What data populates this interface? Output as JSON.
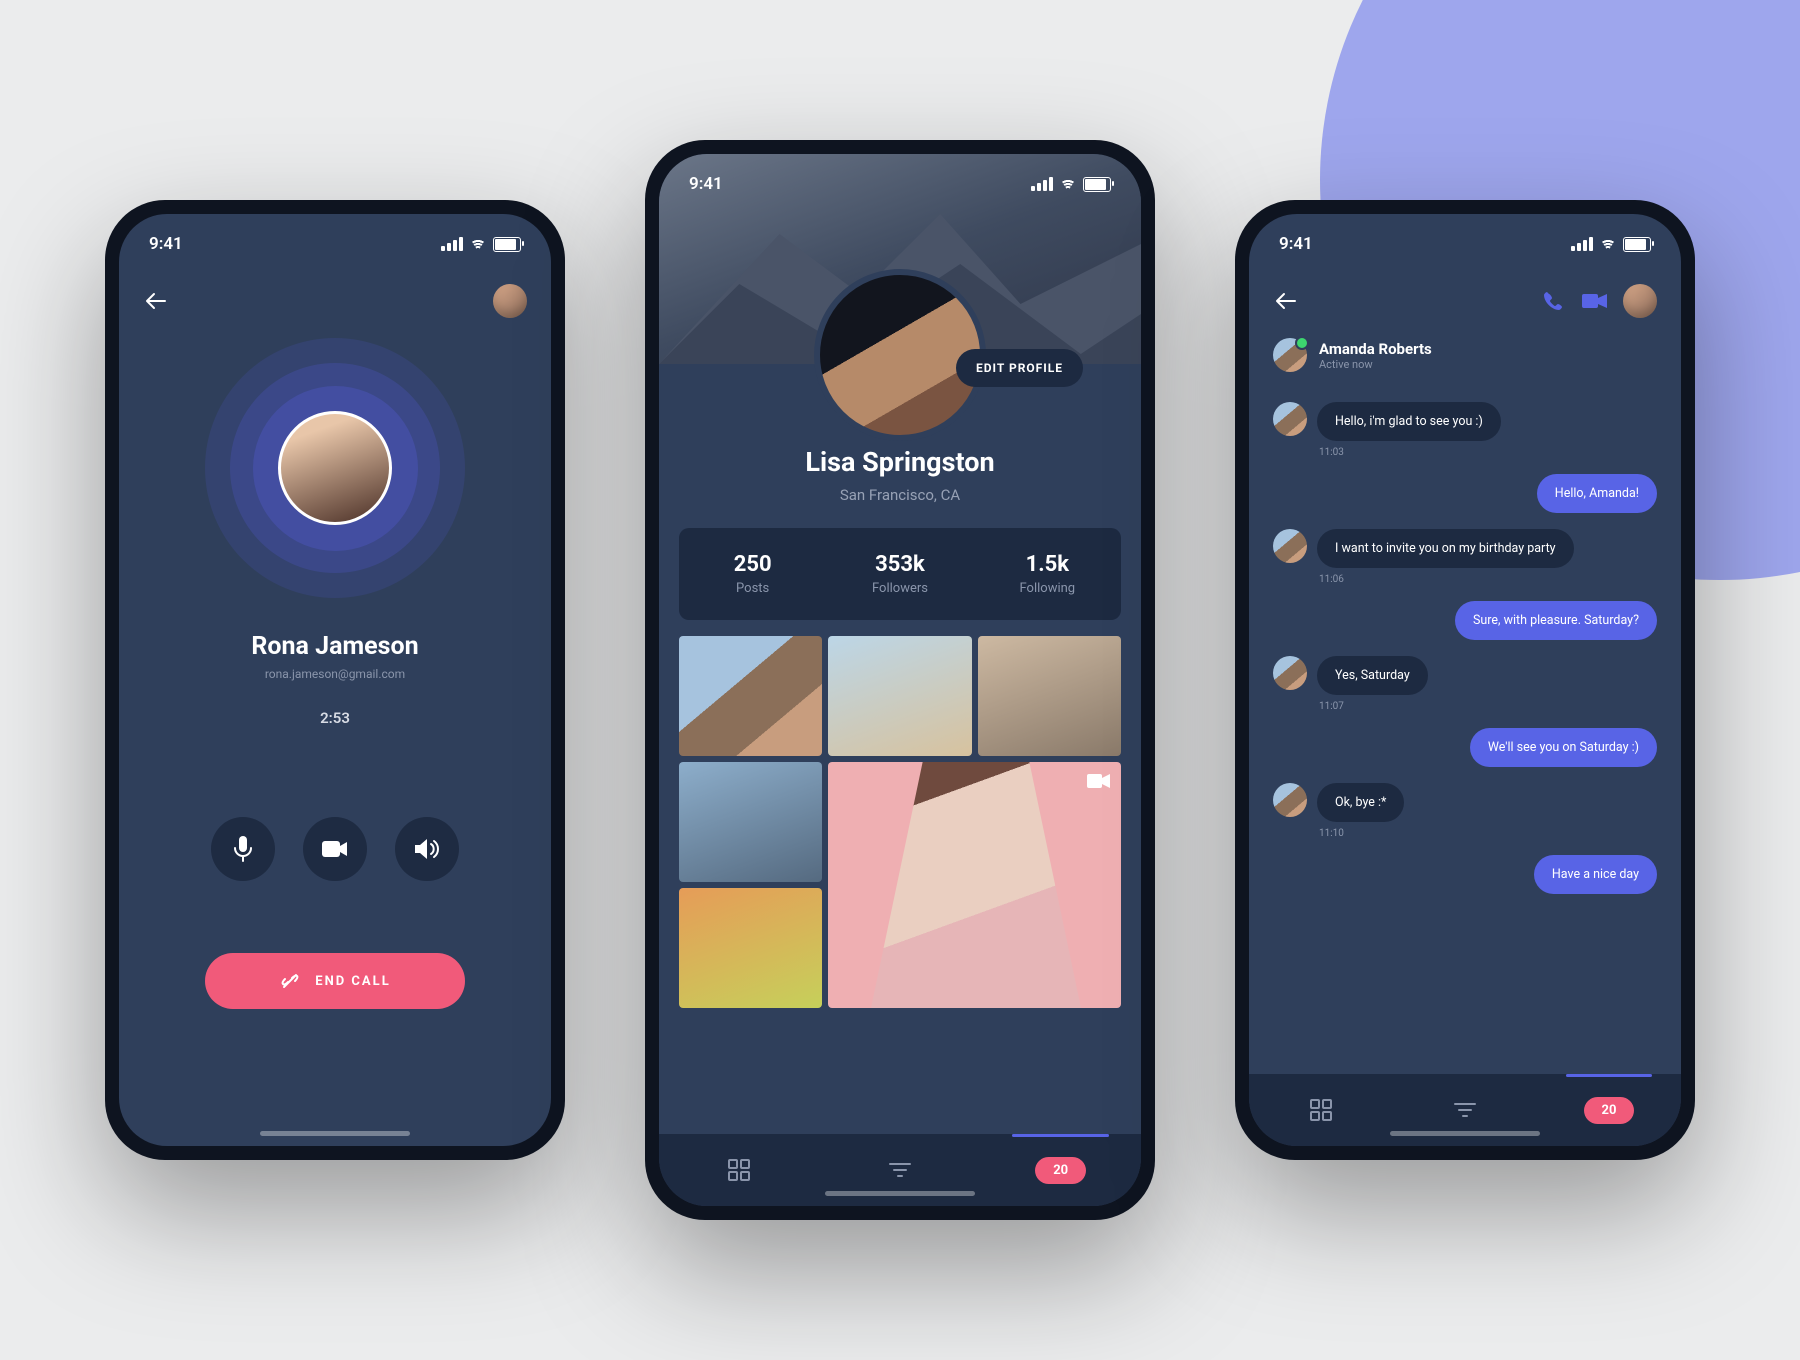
{
  "status": {
    "time": "9:41"
  },
  "call": {
    "name": "Rona Jameson",
    "email": "rona.jameson@gmail.com",
    "duration": "2:53",
    "end_label": "END CALL"
  },
  "profile": {
    "name": "Lisa Springston",
    "location": "San Francisco, CA",
    "edit_label": "EDIT PROFILE",
    "stats": [
      {
        "num": "250",
        "lbl": "Posts"
      },
      {
        "num": "353k",
        "lbl": "Followers"
      },
      {
        "num": "1.5k",
        "lbl": "Following"
      }
    ],
    "badge": "20"
  },
  "chat": {
    "contact": "Amanda Roberts",
    "status": "Active now",
    "messages": [
      {
        "dir": "in",
        "text": "Hello, i'm glad to see you :)",
        "time": "11:03"
      },
      {
        "dir": "out",
        "text": "Hello, Amanda!"
      },
      {
        "dir": "in",
        "text": "I want to invite you on my birthday party",
        "time": "11:06"
      },
      {
        "dir": "out",
        "text": "Sure, with pleasure. Saturday?"
      },
      {
        "dir": "in",
        "text": "Yes, Saturday",
        "time": "11:07"
      },
      {
        "dir": "out",
        "text": "We'll see you on Saturday :)"
      },
      {
        "dir": "in",
        "text": "Ok, bye :*",
        "time": "11:10"
      },
      {
        "dir": "out",
        "text": "Have a nice day"
      }
    ],
    "badge": "20"
  }
}
